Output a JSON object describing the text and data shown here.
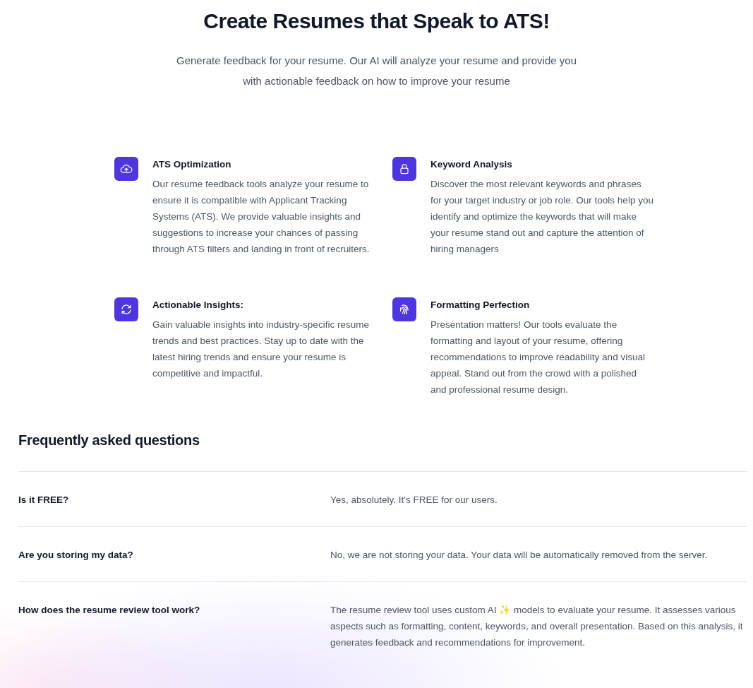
{
  "hero": {
    "title": "Create Resumes that Speak to ATS!",
    "subtitle": "Generate feedback for your resume. Our AI will analyze your resume and provide you with actionable feedback on how to improve your resume"
  },
  "features": [
    {
      "kind": "cloud-upload",
      "title": "ATS Optimization",
      "text": "Our resume feedback tools analyze your resume to ensure it is compatible with Applicant Tracking Systems (ATS). We provide valuable insights and suggestions to increase your chances of passing through ATS filters and landing in front of recruiters."
    },
    {
      "kind": "lock",
      "title": "Keyword Analysis",
      "text": "Discover the most relevant keywords and phrases for your target industry or job role. Our tools help you identify and optimize the keywords that will make your resume stand out and capture the attention of hiring managers"
    },
    {
      "kind": "refresh",
      "title": "Actionable Insights:",
      "text": "Gain valuable insights into industry-specific resume trends and best practices. Stay up to date with the latest hiring trends and ensure your resume is competitive and impactful."
    },
    {
      "kind": "fingerprint",
      "title": "Formatting Perfection",
      "text": "Presentation matters! Our tools evaluate the formatting and layout of your resume, offering recommendations to improve readability and visual appeal. Stand out from the crowd with a polished and professional resume design."
    }
  ],
  "faq": {
    "title": "Frequently asked questions",
    "items": [
      {
        "question": "Is it FREE?",
        "answer": "Yes, absolutely. It's FREE for our users."
      },
      {
        "question": "Are you storing my data?",
        "answer": "No, we are not storing your data. Your data will be automatically removed from the server."
      },
      {
        "question": "How does the resume review tool work?",
        "answer": "The resume review tool uses custom AI ✨ models to evaluate your resume. It assesses various aspects such as formatting, content, keywords, and overall presentation. Based on this analysis, it generates feedback and recommendations for improvement."
      }
    ]
  }
}
